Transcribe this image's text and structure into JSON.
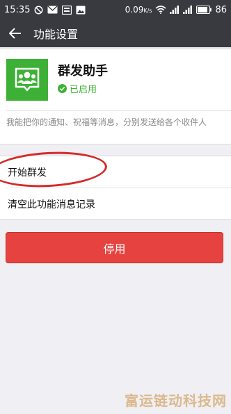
{
  "status_bar": {
    "time": "15:35",
    "battery_percent": "0.09",
    "speed_unit": "K/s",
    "battery_level": "86"
  },
  "header": {
    "title": "功能设置"
  },
  "plugin": {
    "name": "群发助手",
    "status": "已启用",
    "description": "我能把你的通知、祝福等消息，分别发送给各个收件人",
    "accent_color": "#3db135"
  },
  "menu": {
    "items": [
      {
        "label": "开始群发"
      },
      {
        "label": "清空此功能消息记录"
      }
    ]
  },
  "disable_button": {
    "label": "停用",
    "color": "#e64340"
  },
  "watermark": {
    "text": "富运链动科技网"
  }
}
